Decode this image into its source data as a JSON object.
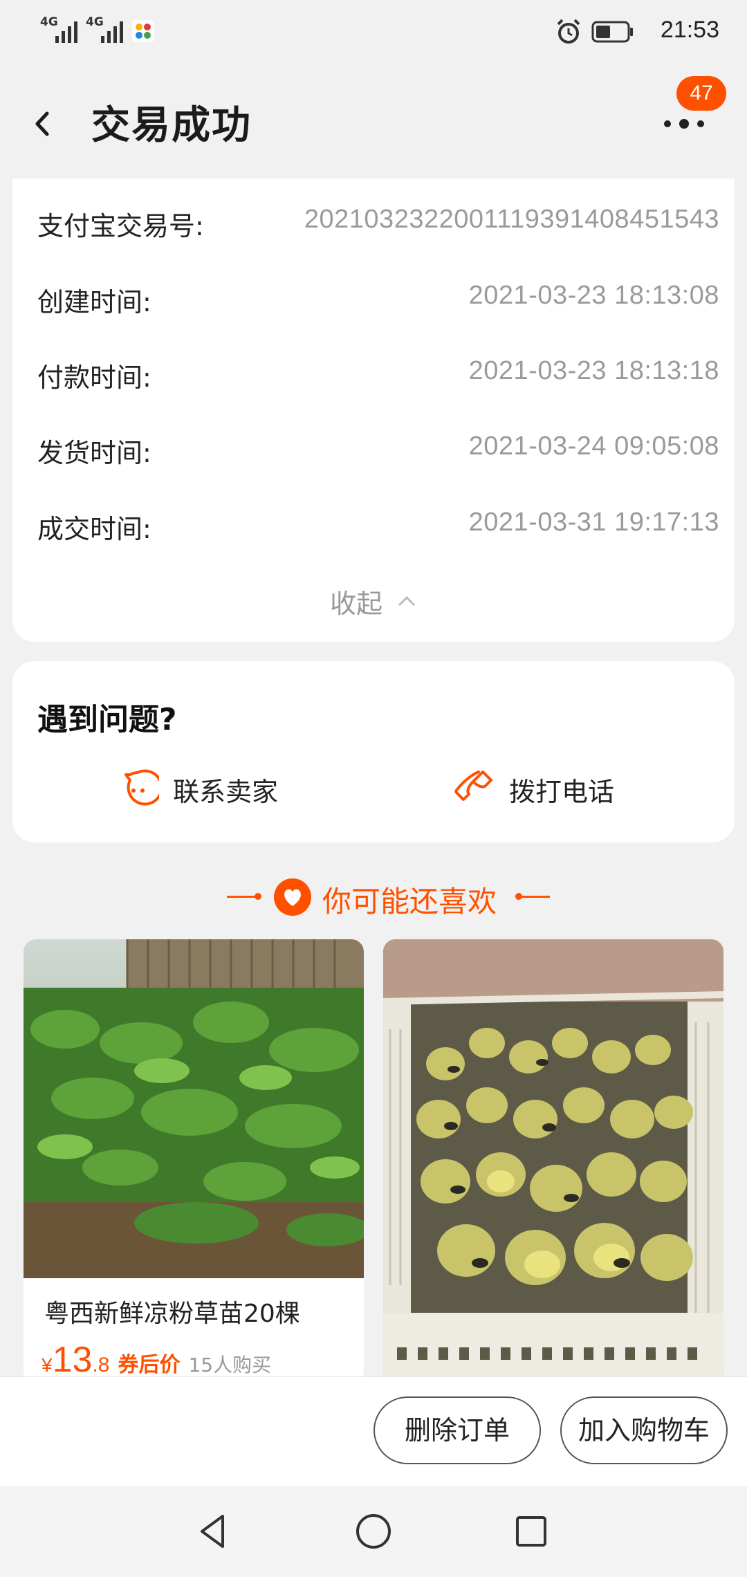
{
  "status_bar": {
    "signal_1_label": "4G",
    "signal_2_label": "4G",
    "time": "21:53",
    "icons": [
      "signal-icon",
      "signal-icon",
      "app-icon",
      "alarm-icon",
      "battery-icon"
    ]
  },
  "header": {
    "title": "交易成功",
    "more_badge": "47"
  },
  "order_details": {
    "rows": [
      {
        "label": "支付宝交易号:",
        "value": "2021032322001119391408451543"
      },
      {
        "label": "创建时间:",
        "value": "2021-03-23 18:13:08"
      },
      {
        "label": "付款时间:",
        "value": "2021-03-23 18:13:18"
      },
      {
        "label": "发货时间:",
        "value": "2021-03-24 09:05:08"
      },
      {
        "label": "成交时间:",
        "value": "2021-03-31 19:17:13"
      }
    ],
    "collapse_label": "收起"
  },
  "problem": {
    "title": "遇到问题?",
    "contact_seller_label": "联系卖家",
    "call_label": "拨打电话"
  },
  "recommend": {
    "title": "你可能还喜欢",
    "products": [
      {
        "name": "粤西新鲜凉粉草苗20棵",
        "price_yen": "¥",
        "price_int": "13",
        "price_dec": ".8",
        "price_tag": "券后价",
        "sold": "15人购买"
      },
      {
        "name": "",
        "price_yen": "",
        "price_int": "",
        "price_dec": "",
        "price_tag": "",
        "sold": ""
      }
    ]
  },
  "actions": {
    "delete_order": "删除订单",
    "add_to_cart": "加入购物车"
  },
  "colors": {
    "accent": "#ff5000",
    "background": "#f1f1f1",
    "muted_text": "#9a9a9a"
  }
}
